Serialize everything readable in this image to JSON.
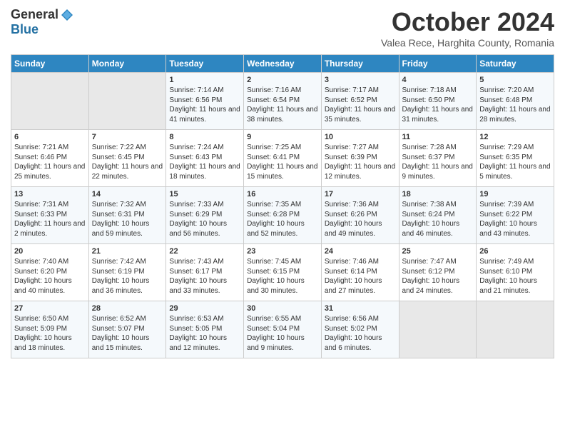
{
  "header": {
    "logo_general": "General",
    "logo_blue": "Blue",
    "month": "October 2024",
    "location": "Valea Rece, Harghita County, Romania"
  },
  "days_of_week": [
    "Sunday",
    "Monday",
    "Tuesday",
    "Wednesday",
    "Thursday",
    "Friday",
    "Saturday"
  ],
  "weeks": [
    [
      {
        "day": "",
        "sunrise": "",
        "sunset": "",
        "daylight": ""
      },
      {
        "day": "",
        "sunrise": "",
        "sunset": "",
        "daylight": ""
      },
      {
        "day": "1",
        "sunrise": "Sunrise: 7:14 AM",
        "sunset": "Sunset: 6:56 PM",
        "daylight": "Daylight: 11 hours and 41 minutes."
      },
      {
        "day": "2",
        "sunrise": "Sunrise: 7:16 AM",
        "sunset": "Sunset: 6:54 PM",
        "daylight": "Daylight: 11 hours and 38 minutes."
      },
      {
        "day": "3",
        "sunrise": "Sunrise: 7:17 AM",
        "sunset": "Sunset: 6:52 PM",
        "daylight": "Daylight: 11 hours and 35 minutes."
      },
      {
        "day": "4",
        "sunrise": "Sunrise: 7:18 AM",
        "sunset": "Sunset: 6:50 PM",
        "daylight": "Daylight: 11 hours and 31 minutes."
      },
      {
        "day": "5",
        "sunrise": "Sunrise: 7:20 AM",
        "sunset": "Sunset: 6:48 PM",
        "daylight": "Daylight: 11 hours and 28 minutes."
      }
    ],
    [
      {
        "day": "6",
        "sunrise": "Sunrise: 7:21 AM",
        "sunset": "Sunset: 6:46 PM",
        "daylight": "Daylight: 11 hours and 25 minutes."
      },
      {
        "day": "7",
        "sunrise": "Sunrise: 7:22 AM",
        "sunset": "Sunset: 6:45 PM",
        "daylight": "Daylight: 11 hours and 22 minutes."
      },
      {
        "day": "8",
        "sunrise": "Sunrise: 7:24 AM",
        "sunset": "Sunset: 6:43 PM",
        "daylight": "Daylight: 11 hours and 18 minutes."
      },
      {
        "day": "9",
        "sunrise": "Sunrise: 7:25 AM",
        "sunset": "Sunset: 6:41 PM",
        "daylight": "Daylight: 11 hours and 15 minutes."
      },
      {
        "day": "10",
        "sunrise": "Sunrise: 7:27 AM",
        "sunset": "Sunset: 6:39 PM",
        "daylight": "Daylight: 11 hours and 12 minutes."
      },
      {
        "day": "11",
        "sunrise": "Sunrise: 7:28 AM",
        "sunset": "Sunset: 6:37 PM",
        "daylight": "Daylight: 11 hours and 9 minutes."
      },
      {
        "day": "12",
        "sunrise": "Sunrise: 7:29 AM",
        "sunset": "Sunset: 6:35 PM",
        "daylight": "Daylight: 11 hours and 5 minutes."
      }
    ],
    [
      {
        "day": "13",
        "sunrise": "Sunrise: 7:31 AM",
        "sunset": "Sunset: 6:33 PM",
        "daylight": "Daylight: 11 hours and 2 minutes."
      },
      {
        "day": "14",
        "sunrise": "Sunrise: 7:32 AM",
        "sunset": "Sunset: 6:31 PM",
        "daylight": "Daylight: 10 hours and 59 minutes."
      },
      {
        "day": "15",
        "sunrise": "Sunrise: 7:33 AM",
        "sunset": "Sunset: 6:29 PM",
        "daylight": "Daylight: 10 hours and 56 minutes."
      },
      {
        "day": "16",
        "sunrise": "Sunrise: 7:35 AM",
        "sunset": "Sunset: 6:28 PM",
        "daylight": "Daylight: 10 hours and 52 minutes."
      },
      {
        "day": "17",
        "sunrise": "Sunrise: 7:36 AM",
        "sunset": "Sunset: 6:26 PM",
        "daylight": "Daylight: 10 hours and 49 minutes."
      },
      {
        "day": "18",
        "sunrise": "Sunrise: 7:38 AM",
        "sunset": "Sunset: 6:24 PM",
        "daylight": "Daylight: 10 hours and 46 minutes."
      },
      {
        "day": "19",
        "sunrise": "Sunrise: 7:39 AM",
        "sunset": "Sunset: 6:22 PM",
        "daylight": "Daylight: 10 hours and 43 minutes."
      }
    ],
    [
      {
        "day": "20",
        "sunrise": "Sunrise: 7:40 AM",
        "sunset": "Sunset: 6:20 PM",
        "daylight": "Daylight: 10 hours and 40 minutes."
      },
      {
        "day": "21",
        "sunrise": "Sunrise: 7:42 AM",
        "sunset": "Sunset: 6:19 PM",
        "daylight": "Daylight: 10 hours and 36 minutes."
      },
      {
        "day": "22",
        "sunrise": "Sunrise: 7:43 AM",
        "sunset": "Sunset: 6:17 PM",
        "daylight": "Daylight: 10 hours and 33 minutes."
      },
      {
        "day": "23",
        "sunrise": "Sunrise: 7:45 AM",
        "sunset": "Sunset: 6:15 PM",
        "daylight": "Daylight: 10 hours and 30 minutes."
      },
      {
        "day": "24",
        "sunrise": "Sunrise: 7:46 AM",
        "sunset": "Sunset: 6:14 PM",
        "daylight": "Daylight: 10 hours and 27 minutes."
      },
      {
        "day": "25",
        "sunrise": "Sunrise: 7:47 AM",
        "sunset": "Sunset: 6:12 PM",
        "daylight": "Daylight: 10 hours and 24 minutes."
      },
      {
        "day": "26",
        "sunrise": "Sunrise: 7:49 AM",
        "sunset": "Sunset: 6:10 PM",
        "daylight": "Daylight: 10 hours and 21 minutes."
      }
    ],
    [
      {
        "day": "27",
        "sunrise": "Sunrise: 6:50 AM",
        "sunset": "Sunset: 5:09 PM",
        "daylight": "Daylight: 10 hours and 18 minutes."
      },
      {
        "day": "28",
        "sunrise": "Sunrise: 6:52 AM",
        "sunset": "Sunset: 5:07 PM",
        "daylight": "Daylight: 10 hours and 15 minutes."
      },
      {
        "day": "29",
        "sunrise": "Sunrise: 6:53 AM",
        "sunset": "Sunset: 5:05 PM",
        "daylight": "Daylight: 10 hours and 12 minutes."
      },
      {
        "day": "30",
        "sunrise": "Sunrise: 6:55 AM",
        "sunset": "Sunset: 5:04 PM",
        "daylight": "Daylight: 10 hours and 9 minutes."
      },
      {
        "day": "31",
        "sunrise": "Sunrise: 6:56 AM",
        "sunset": "Sunset: 5:02 PM",
        "daylight": "Daylight: 10 hours and 6 minutes."
      },
      {
        "day": "",
        "sunrise": "",
        "sunset": "",
        "daylight": ""
      },
      {
        "day": "",
        "sunrise": "",
        "sunset": "",
        "daylight": ""
      }
    ]
  ]
}
